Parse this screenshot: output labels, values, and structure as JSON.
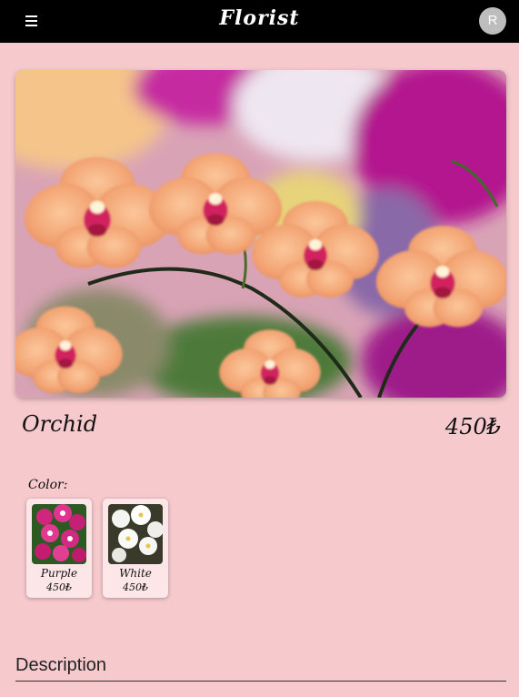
{
  "header": {
    "brand": "Florist",
    "menu_icon": "hamburger-menu-icon",
    "avatar_initial": "R"
  },
  "carousel": {
    "image": "orange-orchids-photo",
    "slide_count": 2,
    "active_slide": 1
  },
  "product": {
    "name": "Orchid",
    "price": "450₺"
  },
  "options": {
    "label": "Color:",
    "items": [
      {
        "name": "Purple",
        "price": "450₺",
        "image": "purple-orchid-thumbnail"
      },
      {
        "name": "White",
        "price": "450₺",
        "image": "white-orchid-thumbnail"
      }
    ]
  },
  "description": {
    "heading": "Description"
  },
  "colors": {
    "background": "#f6c9cd",
    "topbar": "#000000",
    "card": "#fde6e8",
    "avatar": "#bdbdbd"
  }
}
